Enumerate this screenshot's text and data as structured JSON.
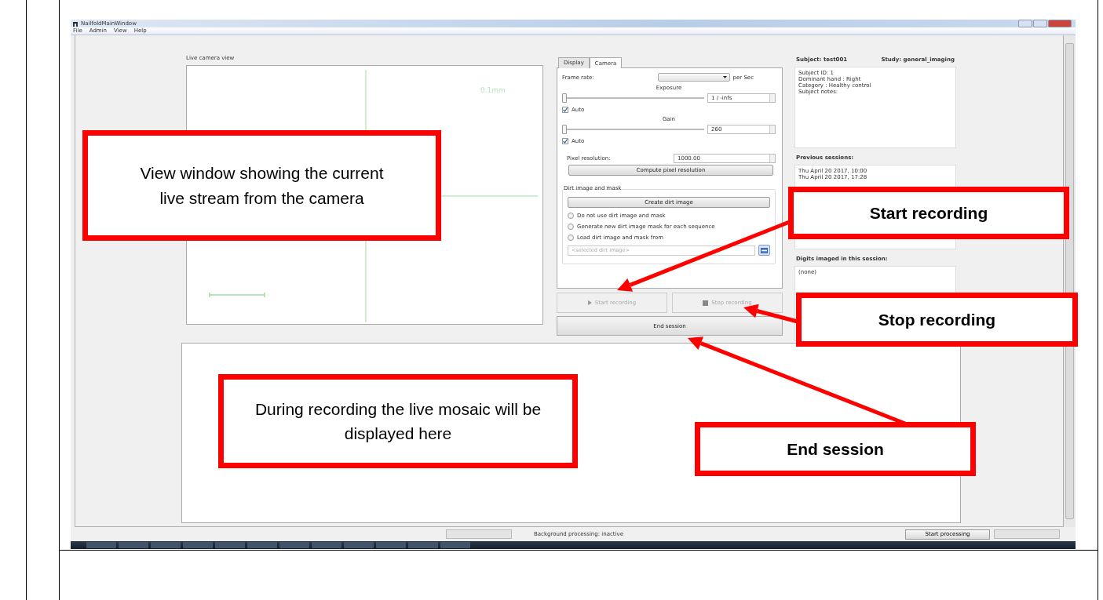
{
  "window": {
    "title": "NailfoldMainWindow"
  },
  "menu": [
    "File",
    "Admin",
    "View",
    "Help"
  ],
  "camera_view": {
    "label": "Live camera view",
    "scale_text": "0.1mm"
  },
  "tabs": [
    {
      "label": "Display",
      "selected": false
    },
    {
      "label": "Camera",
      "selected": true
    }
  ],
  "camera": {
    "frame_rate_label": "Frame rate:",
    "frame_rate_unit": "per Sec",
    "sliders": [
      {
        "label": "Exposure",
        "level": 0,
        "value": "1 / -infs",
        "auto": {
          "label": "Auto",
          "checked": true
        }
      },
      {
        "label": "Gain",
        "level": 0,
        "value": "260",
        "auto": {
          "label": "Auto",
          "checked": true
        }
      }
    ],
    "pixel_resolution_label": "Pixel resolution:",
    "pixel_resolution": "1000.00",
    "compute_button": "Compute pixel resolution",
    "dirt": {
      "title": "Dirt image and mask",
      "create_button": "Create dirt image",
      "options": [
        {
          "label": "Do not use dirt image and mask",
          "selected": false
        },
        {
          "label": "Generate new dirt image mask for each sequence",
          "selected": false
        },
        {
          "label": "Load dirt image and mask from",
          "selected": false
        }
      ],
      "placeholder": "<selected dirt image>"
    }
  },
  "recording_buttons": [
    {
      "label": "Start recording",
      "kind": "play",
      "disabled": true
    },
    {
      "label": "Stop recording",
      "kind": "stop",
      "disabled": true
    }
  ],
  "end_session": {
    "label": "End session",
    "disabled": false
  },
  "subject": {
    "title": "Subject: test001",
    "study": "Study: general_imaging",
    "details": [
      "Subject ID: 1",
      "Dominant hand : Right",
      "Category : Healthy control",
      "Subject notes:"
    ],
    "previous_label": "Previous sessions:",
    "previous_sessions": [
      "Thu April 20 2017, 10:00",
      "Thu April 20 2017, 17:28"
    ],
    "digits_label": "Digits imaged in this session:",
    "digits": [
      "(none)"
    ]
  },
  "status_bar": {
    "text": "Background processing: inactive",
    "button": "Start processing"
  },
  "annotations": [
    {
      "text": "View window showing the current live stream from the camera",
      "bold": false
    },
    {
      "text": "Start recording",
      "bold": true
    },
    {
      "text": "Stop recording",
      "bold": true
    },
    {
      "text": "During recording the live mosaic will be displayed here",
      "bold": false
    },
    {
      "text": "End session",
      "bold": true
    }
  ]
}
